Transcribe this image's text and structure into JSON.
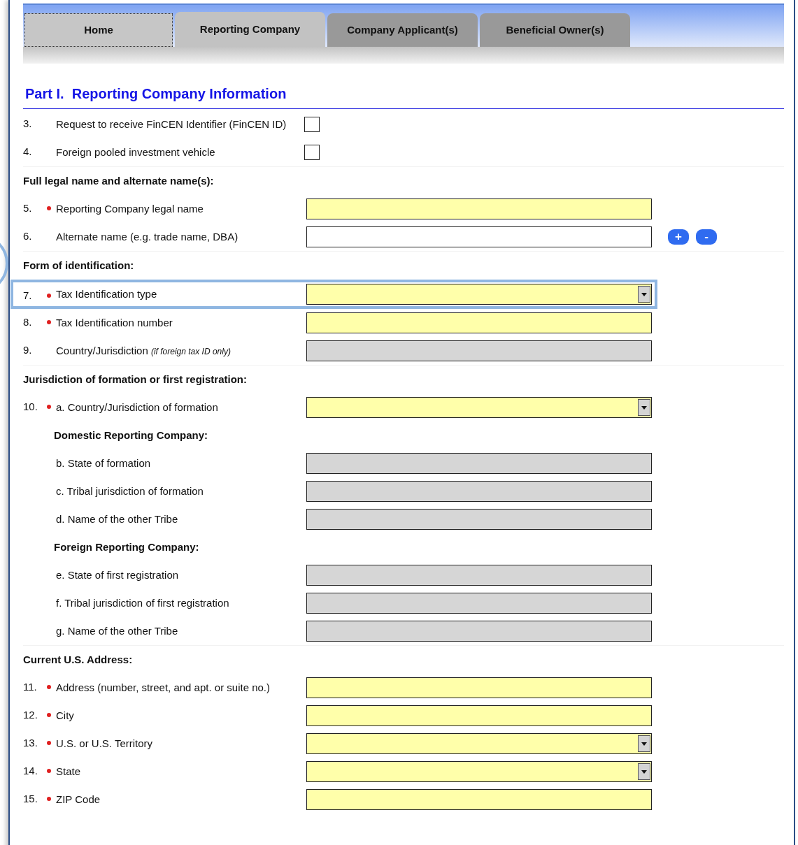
{
  "tabs": [
    {
      "label": "Home",
      "selected": false,
      "focused": true
    },
    {
      "label": "Reporting Company",
      "selected": true,
      "focused": false
    },
    {
      "label": "Company Applicant(s)",
      "selected": false,
      "focused": false
    },
    {
      "label": "Beneficial Owner(s)",
      "selected": false,
      "focused": false
    }
  ],
  "title": "Part I.  Reporting Company Information",
  "sections": [
    {
      "items": [
        {
          "kind": "checkbox",
          "number": "3.",
          "label": "Request to receive FinCEN Identifier (FinCEN ID)",
          "checked": false
        },
        {
          "kind": "checkbox",
          "number": "4.",
          "label": "Foreign pooled investment vehicle",
          "checked": false
        }
      ]
    },
    {
      "heading": "Full legal name and alternate name(s):",
      "items": [
        {
          "kind": "field",
          "number": "5.",
          "required": true,
          "label": "Reporting Company legal name",
          "disabled": false,
          "dropdown": false,
          "highlighted": false
        },
        {
          "kind": "field",
          "number": "6.",
          "required": false,
          "label": "Alternate name (e.g. trade name, DBA)",
          "disabled": false,
          "dropdown": false,
          "highlighted": false,
          "buttons": [
            {
              "label": "+"
            },
            {
              "label": "-"
            }
          ]
        }
      ]
    },
    {
      "heading": "Form of identification:",
      "items": [
        {
          "kind": "field",
          "number": "7.",
          "required": true,
          "label": "Tax Identification type",
          "disabled": false,
          "dropdown": true,
          "highlighted": true
        },
        {
          "kind": "field",
          "number": "8.",
          "required": true,
          "label": "Tax Identification number",
          "disabled": false,
          "dropdown": false,
          "highlighted": false
        },
        {
          "kind": "field",
          "number": "9.",
          "required": false,
          "label": "Country/Jurisdiction *(if foreign tax ID only)*",
          "disabled": true,
          "dropdown": false,
          "highlighted": false
        }
      ]
    },
    {
      "heading": "Jurisdiction of formation or first registration:",
      "items": [
        {
          "kind": "field",
          "number": "10.",
          "required": true,
          "label": "a. Country/Jurisdiction of formation",
          "disabled": false,
          "dropdown": true,
          "highlighted": false
        },
        {
          "kind": "subheading",
          "label": "Domestic Reporting Company:"
        },
        {
          "kind": "field",
          "required": false,
          "label": "b. State of formation",
          "disabled": true,
          "dropdown": false,
          "highlighted": false
        },
        {
          "kind": "field",
          "required": false,
          "label": "c. Tribal jurisdiction of formation",
          "disabled": true,
          "dropdown": false,
          "highlighted": false
        },
        {
          "kind": "field",
          "required": false,
          "label": "d. Name of the other Tribe",
          "disabled": true,
          "dropdown": false,
          "highlighted": false
        },
        {
          "kind": "subheading",
          "label": "Foreign Reporting Company:"
        },
        {
          "kind": "field",
          "required": false,
          "label": "e. State of first registration",
          "disabled": true,
          "dropdown": false,
          "highlighted": false
        },
        {
          "kind": "field",
          "required": false,
          "label": "f. Tribal jurisdiction of first registration",
          "disabled": true,
          "dropdown": false,
          "highlighted": false
        },
        {
          "kind": "field",
          "required": false,
          "label": "g. Name of the other Tribe",
          "disabled": true,
          "dropdown": false,
          "highlighted": false
        }
      ]
    },
    {
      "heading": "Current U.S. Address:",
      "items": [
        {
          "kind": "field",
          "number": "11.",
          "required": true,
          "label": "Address (number, street, and apt. or suite no.)",
          "disabled": false,
          "dropdown": false,
          "highlighted": false
        },
        {
          "kind": "field",
          "number": "12.",
          "required": true,
          "label": "City",
          "disabled": false,
          "dropdown": false,
          "highlighted": false
        },
        {
          "kind": "field",
          "number": "13.",
          "required": true,
          "label": "U.S. or U.S. Territory",
          "disabled": false,
          "dropdown": true,
          "highlighted": false
        },
        {
          "kind": "field",
          "number": "14.",
          "required": true,
          "label": "State",
          "disabled": false,
          "dropdown": true,
          "highlighted": false
        },
        {
          "kind": "field",
          "number": "15.",
          "required": true,
          "label": "ZIP Code",
          "disabled": false,
          "dropdown": false,
          "highlighted": false
        }
      ]
    }
  ]
}
